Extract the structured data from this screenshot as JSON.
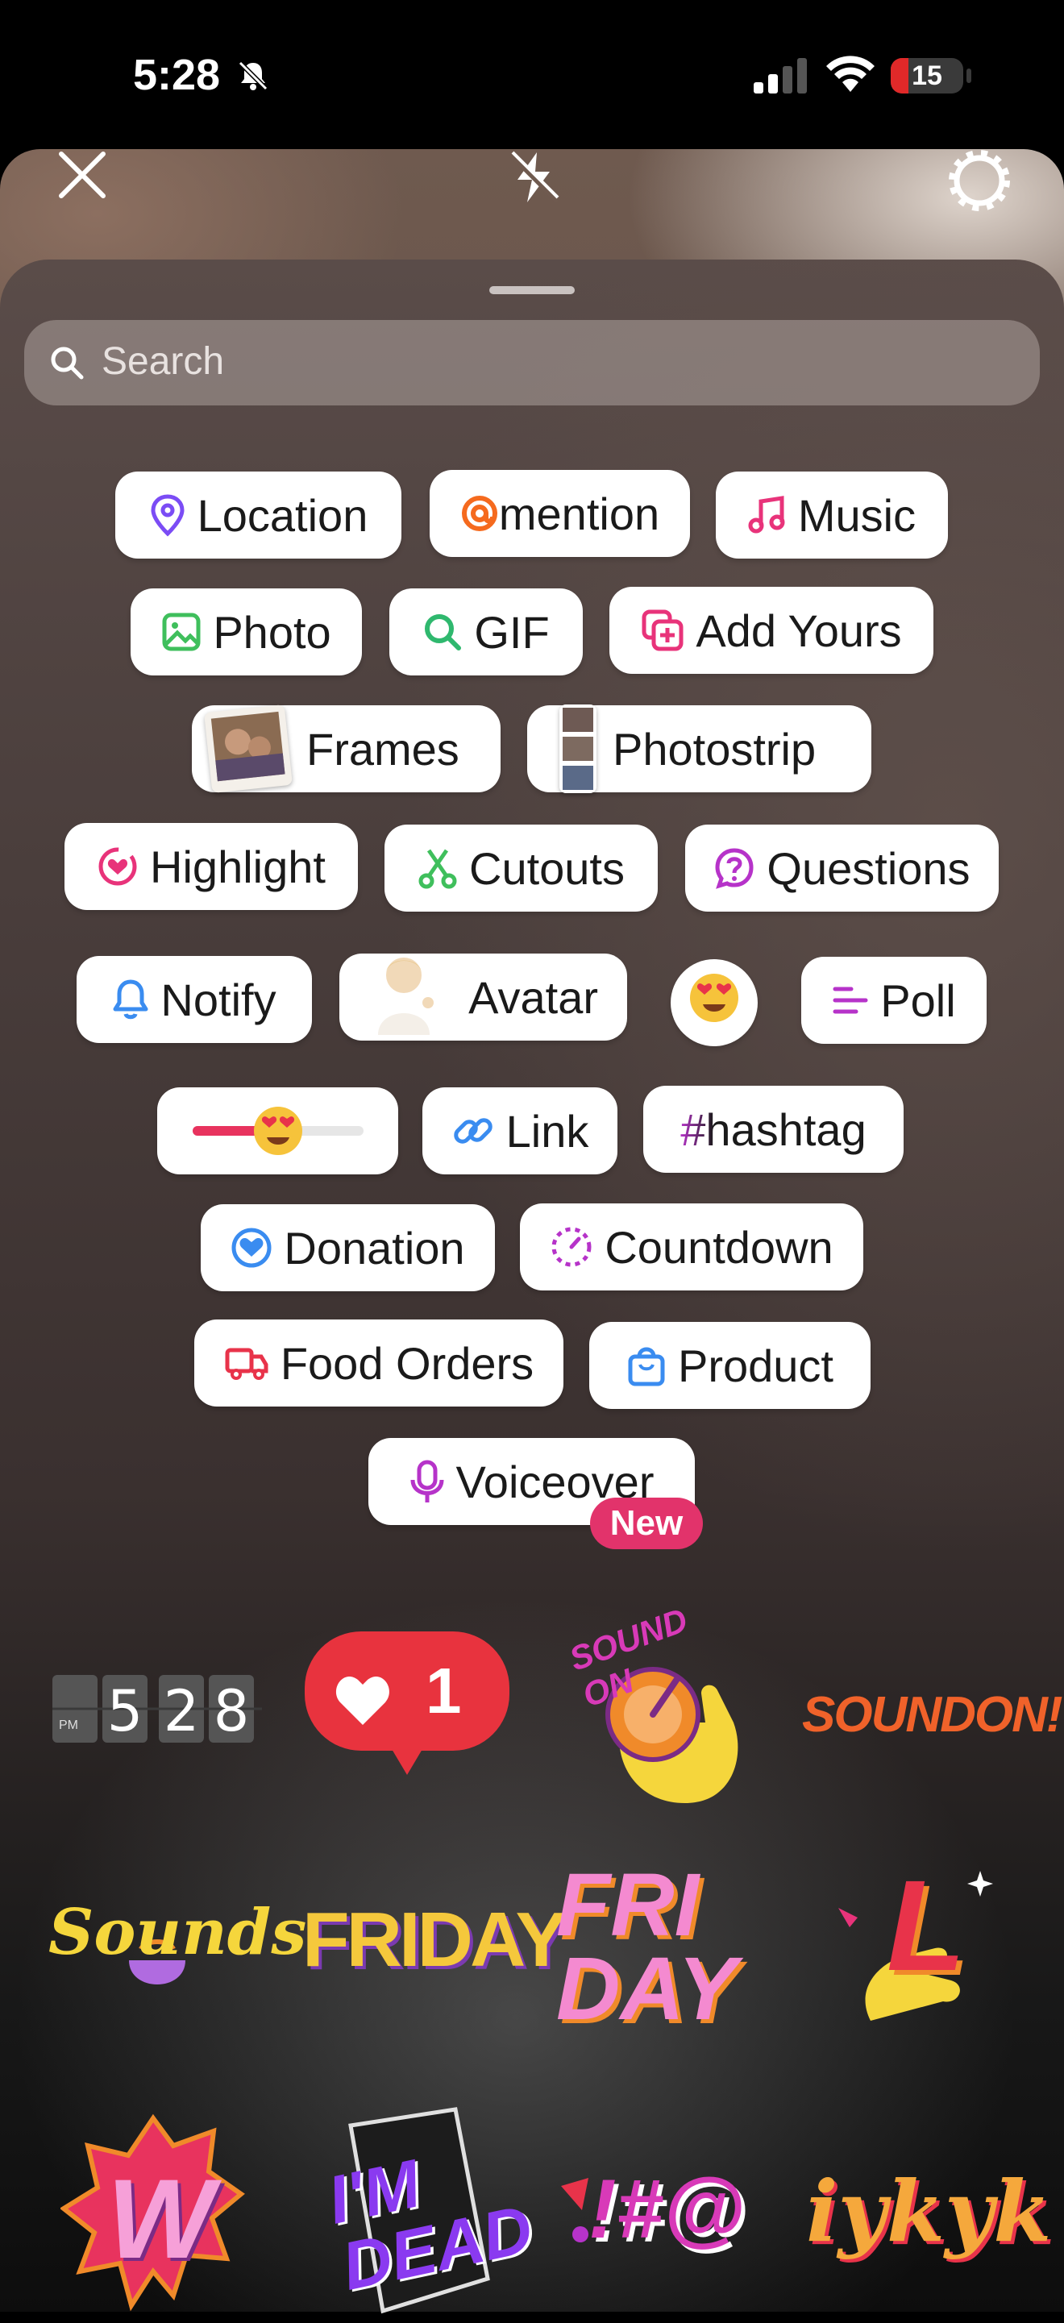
{
  "status_bar": {
    "time": "5:28",
    "battery": "15"
  },
  "search": {
    "placeholder": "Search"
  },
  "stickers": {
    "location": "Location",
    "mention": "mention",
    "music": "Music",
    "photo": "Photo",
    "gif": "GIF",
    "add_yours": "Add Yours",
    "frames": "Frames",
    "photostrip": "Photostrip",
    "highlight": "Highlight",
    "cutouts": "Cutouts",
    "questions": "Questions",
    "notify": "Notify",
    "avatar": "Avatar",
    "poll": "Poll",
    "link": "Link",
    "hashtag": "#hashtag",
    "donation": "Donation",
    "countdown": "Countdown",
    "food_orders": "Food Orders",
    "product": "Product",
    "voiceover": "Voiceover",
    "new_badge": "New"
  },
  "stickers_row": {
    "clock_digits": [
      "5",
      "2",
      "8"
    ],
    "clock_ampm": "PM",
    "likes_count": "1",
    "sound_on": "SOUND ON",
    "sound_on_2": "SOUNDON!",
    "sounds": "Sounds",
    "friday": "FRIDAY",
    "fri_day": "FRI DAY",
    "l_letter": "L",
    "w_letter": "W",
    "im_dead": "I'M DEAD",
    "symbols": "!#@",
    "iykyk": "iykyk"
  },
  "colors": {
    "location": "#7b4cf5",
    "mention": "#f56a1e",
    "music": "#e8337a",
    "photo": "#3fbf5c",
    "gif": "#2fb86e",
    "add_yours": "#e8337a",
    "highlight": "#e8337a",
    "cutouts": "#3fbf5c",
    "questions": "#b633c9",
    "notify": "#3a8cf0",
    "poll": "#b633c9",
    "link": "#3a8cf0",
    "hashtag": "#c433c4",
    "donation": "#3a8cf0",
    "countdown": "#b633c9",
    "food_orders": "#e8334a",
    "product": "#3a8cf0",
    "voiceover": "#b633c9"
  }
}
